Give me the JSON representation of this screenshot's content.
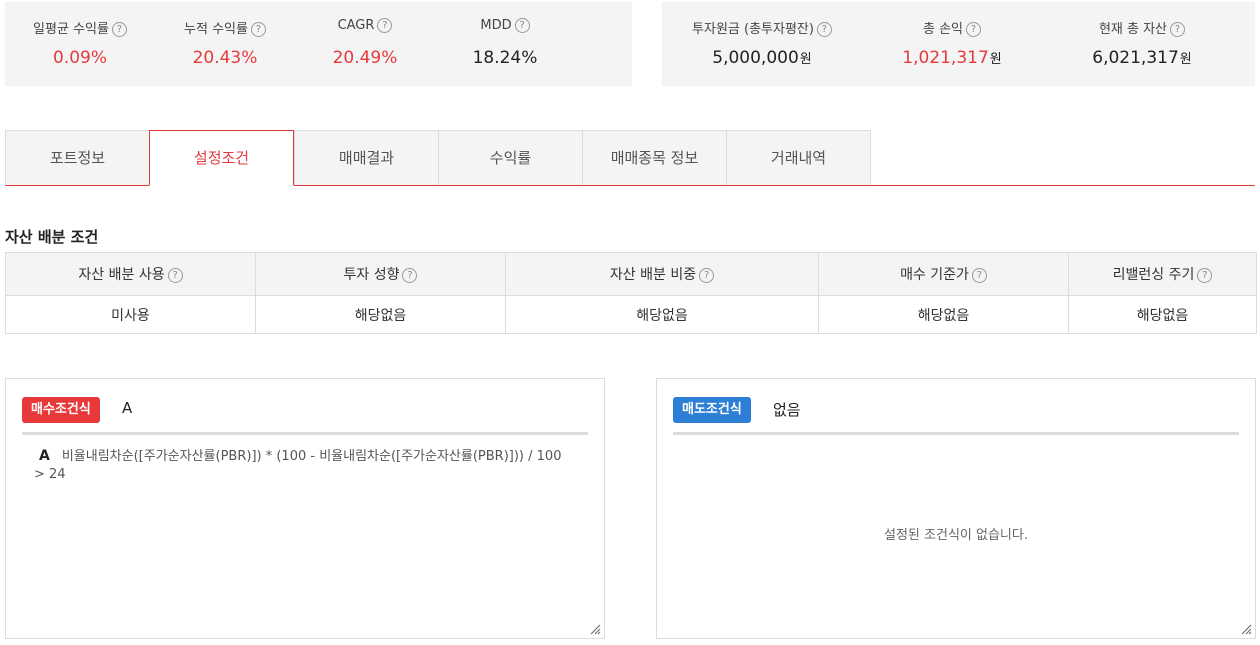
{
  "summary_left": [
    {
      "label": "일평균 수익률",
      "value": "0.09%",
      "color": "red"
    },
    {
      "label": "누적 수익률",
      "value": "20.43%",
      "color": "red"
    },
    {
      "label": "CAGR",
      "value": "20.49%",
      "color": "red"
    },
    {
      "label": "MDD",
      "value": "18.24%",
      "color": "black"
    }
  ],
  "summary_right": [
    {
      "label": "투자원금 (총투자평잔)",
      "value": "5,000,000",
      "unit": "원",
      "color": "black"
    },
    {
      "label": "총 손익",
      "value": "1,021,317",
      "unit": "원",
      "color": "red"
    },
    {
      "label": "현재 총 자산",
      "value": "6,021,317",
      "unit": "원",
      "color": "black"
    }
  ],
  "help_icon_glyph": "?",
  "tabs": [
    "포트정보",
    "설정조건",
    "매매결과",
    "수익률",
    "매매종목 정보",
    "거래내역"
  ],
  "active_tab": "설정조건",
  "section_title": "자산 배분 조건",
  "alloc_table": {
    "headers": [
      "자산 배분 사용",
      "투자 성향",
      "자산 배분 비중",
      "매수 기준가",
      "리밸런싱 주기"
    ],
    "values": [
      "미사용",
      "해당없음",
      "해당없음",
      "해당없음",
      "해당없음"
    ]
  },
  "buy": {
    "badge": "매수조건식",
    "value": "A",
    "formula_name": "A",
    "formula": "비율내림차순([주가순자산률(PBR)]) * (100 - 비율내림차순([주가순자산률(PBR)])) / 100",
    "formula_tail": "> 24"
  },
  "sell": {
    "badge": "매도조건식",
    "value": "없음",
    "empty_message": "설정된 조건식이 없습니다."
  },
  "colors": {
    "accent_red": "#e8393a",
    "accent_blue": "#2c7fd4",
    "tab_red": "#e03a3e"
  }
}
